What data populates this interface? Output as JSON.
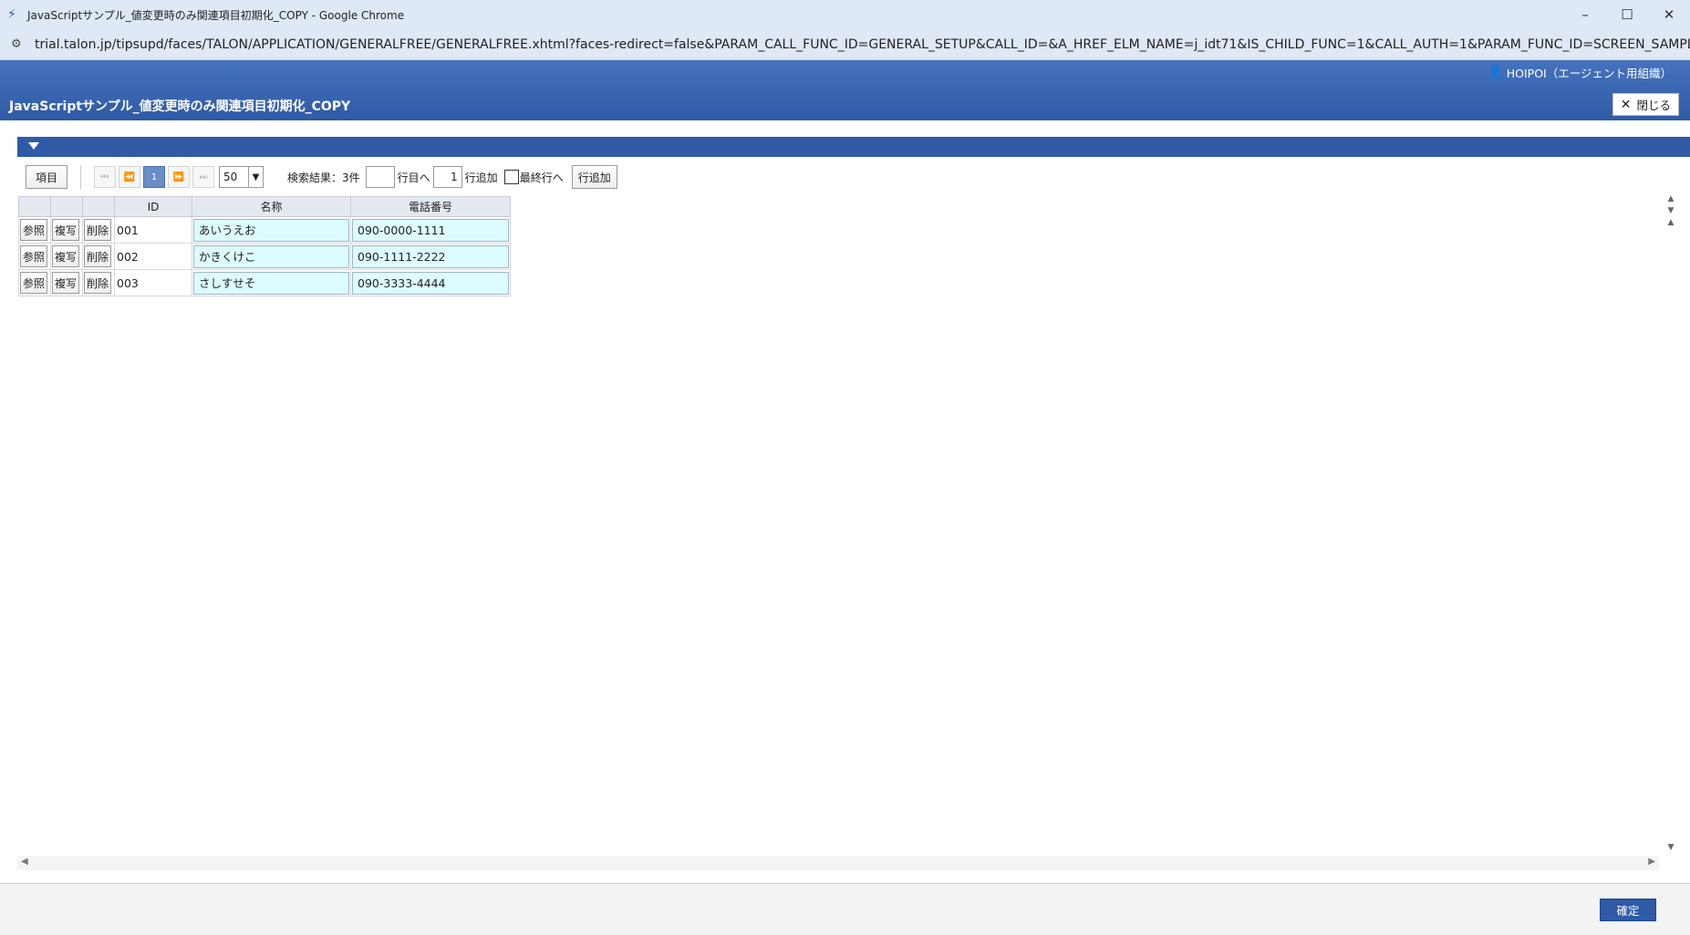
{
  "window": {
    "title": "JavaScriptサンプル_値変更時のみ関連項目初期化_COPY - Google Chrome",
    "app_icon": "talon-logo-icon",
    "controls": {
      "minimize": "–",
      "maximize": "☐",
      "close": "✕"
    }
  },
  "address_bar": {
    "site_info_icon": "site-settings-icon",
    "url": "trial.talon.jp/tipsupd/faces/TALON/APPLICATION/GENERALFREE/GENERALFREE.xhtml?faces-redirect=false&PARAM_CALL_FUNC_ID=GENERAL_SETUP&CALL_ID=&A_HREF_ELM_NAME=j_idt71&IS_CHILD_FUNC=1&CALL_AUTH=1&PARAM_FUNC_ID=SCREEN_SAMPLE_0611_DATA_COPY&INI..."
  },
  "header": {
    "user_label": "HOIPOI（エージェント用組織）",
    "page_title": "JavaScriptサンプル_値変更時のみ関連項目初期化_COPY",
    "close_label": "閉じる"
  },
  "toolbar": {
    "items_label": "項目",
    "current_page": "1",
    "page_size": "50",
    "result_text": "検索結果：3件",
    "goto_row_value": "",
    "goto_row_label": "行目へ",
    "add_count_value": "1",
    "add_label": "行追加",
    "last_row_label": "最終行へ",
    "add_row_button": "行追加"
  },
  "table": {
    "headers": {
      "col1": "",
      "col2": "",
      "col3": "",
      "id": "ID",
      "name": "名称",
      "phone": "電話番号"
    },
    "row_buttons": {
      "view": "参照",
      "copy": "複写",
      "delete": "削除"
    },
    "rows": [
      {
        "id": "001",
        "name": "あいうえお",
        "phone": "090-0000-1111"
      },
      {
        "id": "002",
        "name": "かきくけこ",
        "phone": "090-1111-2222"
      },
      {
        "id": "003",
        "name": "さしすせそ",
        "phone": "090-3333-4444"
      }
    ]
  },
  "footer": {
    "confirm_label": "確定"
  }
}
